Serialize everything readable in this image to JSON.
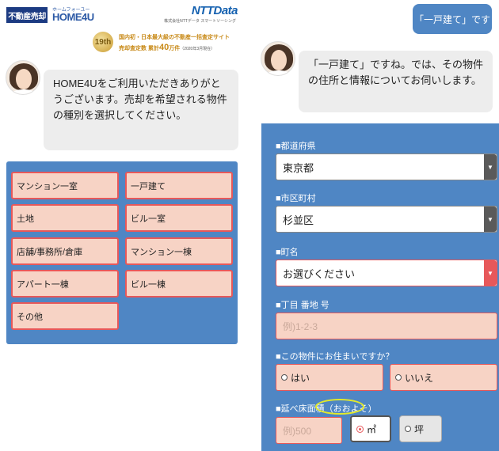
{
  "header": {
    "badge": "不動産売却",
    "logo_small": "ホームフォーユー",
    "logo": "HOME4U",
    "ntt": "NTTData",
    "ntt_sub": "株式会社NTTデータ スマートソーシング",
    "medal": "19th",
    "claim_line1": "国内初・日本最大級の不動産一括査定サイト",
    "claim_line2_prefix": "売却査定数 累計",
    "claim_line2_big": "40",
    "claim_line2_suffix": "万件",
    "claim_line2_note": "（2020年3月現在）"
  },
  "left_chat": {
    "message": "HOME4Uをご利用いただきありがとうございます。売却を希望される物件の種別を選択してください。",
    "categories": [
      "マンション一室",
      "一戸建て",
      "土地",
      "ビル一室",
      "店舗/事務所/倉庫",
      "マンション一棟",
      "アパート一棟",
      "ビル一棟",
      "その他"
    ]
  },
  "right_chat": {
    "user_message": "「一戸建て」です",
    "bot_message": "「一戸建て」ですね。では、その物件の住所と情報についてお伺いします。"
  },
  "form": {
    "prefecture_label": "■都道府県",
    "prefecture_value": "東京都",
    "city_label": "■市区町村",
    "city_value": "杉並区",
    "town_label": "■町名",
    "town_value": "お選びください",
    "chome_label": "■丁目 番地 号",
    "chome_placeholder": "例)1-2-3",
    "residence_label": "■この物件にお住まいですか？",
    "residence_yes": "はい",
    "residence_no": "いいえ",
    "floor_label_prefix": "■延べ床面積",
    "floor_label_highlight": "（おおよそ）",
    "floor_placeholder": "例)500",
    "unit_m2": "㎡",
    "unit_tsubo": "坪",
    "selected_unit": "m2"
  },
  "colors": {
    "panel_blue": "#4f86c4",
    "button_fill": "#f7d3c5",
    "button_border": "#e7585a",
    "highlight": "#e3ea2a"
  }
}
